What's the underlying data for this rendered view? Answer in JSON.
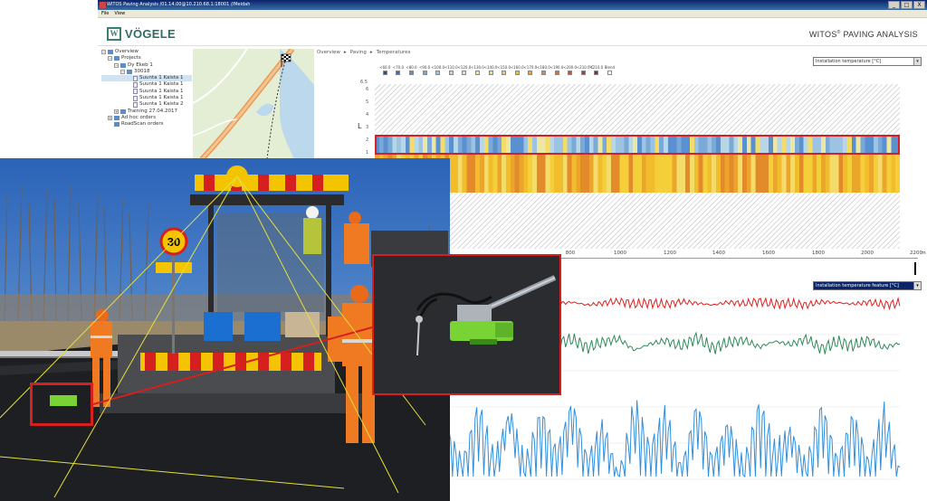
{
  "window": {
    "title": "WITOS Paving Analysis /01.14.00@10.210.68.1:18001 //Meidah",
    "buttons": [
      "_",
      "□",
      "X"
    ]
  },
  "menu": [
    "File",
    "View"
  ],
  "header": {
    "logo_mark": "W",
    "logo_text": "VÖGELE",
    "app_title": "WITOS",
    "app_title_reg": "®",
    "app_title_rest": " PAVING ANALYSIS"
  },
  "tree": [
    {
      "label": "Overview",
      "level": 0,
      "box": "−",
      "icon": "folder"
    },
    {
      "label": "Projects",
      "level": 1,
      "box": "−",
      "icon": "folder"
    },
    {
      "label": "Dy Ekeb 1",
      "level": 2,
      "box": "−",
      "icon": "folder"
    },
    {
      "label": "30018",
      "level": 3,
      "box": "−",
      "icon": "folder"
    },
    {
      "label": "Suunta 1 Kaista 1",
      "level": 4,
      "box": "",
      "icon": "doc",
      "selected": true
    },
    {
      "label": "Suunta 1 Kaista 1",
      "level": 4,
      "box": "",
      "icon": "doc"
    },
    {
      "label": "Suunta 1 Kaista 1",
      "level": 4,
      "box": "",
      "icon": "doc"
    },
    {
      "label": "Suunta 1 Kaista 1",
      "level": 4,
      "box": "",
      "icon": "doc"
    },
    {
      "label": "Suunta 1 Kaista 2",
      "level": 4,
      "box": "",
      "icon": "doc"
    },
    {
      "label": "Training 27.04.2017",
      "level": 2,
      "box": "+",
      "icon": "folder"
    },
    {
      "label": "Ad hoc orders",
      "level": 1,
      "box": "+",
      "icon": "folder"
    },
    {
      "label": "RoadScan orders",
      "level": 1,
      "box": "",
      "icon": "folder"
    }
  ],
  "breadcrumb": [
    "Overview",
    "▸",
    "Paving",
    "▸",
    "Temperatures"
  ],
  "select_top": {
    "value": "Installation temperature [°C]"
  },
  "select_bottom": {
    "value": "Installation temperature feature [°C]"
  },
  "legend": {
    "labels": [
      "<60.0",
      "<70.0",
      "<80.0",
      "<90.0",
      "<100.0",
      "<110.0",
      "<120.0",
      "<130.0",
      "<140.0",
      "<150.0",
      "<160.0",
      "<170.0",
      "<180.0",
      "<190.0",
      "<200.0",
      "<210.0",
      "<210.0",
      "Blend"
    ],
    "colors": [
      "#2a4f8f",
      "#3b6bb4",
      "#5a8fd0",
      "#7aa9d8",
      "#9cc3e2",
      "#b9d6e6",
      "#d6e5d1",
      "#ece7a5",
      "#f4dc6a",
      "#f5cf3a",
      "#f2bd2c",
      "#eba52a",
      "#e38b2a",
      "#da6f29",
      "#cf5127",
      "#c23424",
      "#a81d1d",
      "#ffffff"
    ],
    "unit": "°C"
  },
  "heatmap": {
    "y_ticks": [
      "6.5",
      "6",
      "5",
      "4",
      "3",
      "2",
      "1"
    ],
    "y_label": "L"
  },
  "x_axis": {
    "ticks": [
      "800",
      "1000",
      "1200",
      "1400",
      "1600",
      "1800",
      "2000",
      "2200"
    ],
    "unit": "m"
  },
  "chart_data": {
    "type": "line",
    "title": "",
    "xlabel": "",
    "ylabel": "",
    "series": [
      {
        "name": "",
        "color": "#e02020",
        "level": "high",
        "values": [
          0.9,
          0.86,
          0.93,
          0.88,
          0.91,
          0.87,
          0.94,
          0.89,
          0.92,
          0.86,
          0.9,
          0.95,
          0.88,
          0.91,
          0.87,
          0.93,
          0.9,
          0.86,
          0.92,
          0.89,
          0.94,
          0.88,
          0.9,
          0.86,
          0.93,
          0.91,
          0.88,
          0.92,
          0.87,
          0.9
        ]
      },
      {
        "name": "",
        "color": "#2e8b57",
        "level": "mid",
        "values": [
          0.72,
          0.8,
          0.65,
          0.78,
          0.7,
          0.83,
          0.66,
          0.75,
          0.81,
          0.68,
          0.77,
          0.82,
          0.64,
          0.74,
          0.79,
          0.7,
          0.84,
          0.67,
          0.76,
          0.8,
          0.69,
          0.78,
          0.73,
          0.82,
          0.66,
          0.77,
          0.71,
          0.8,
          0.68,
          0.75
        ]
      },
      {
        "name": "",
        "color": "#2f8fdc",
        "level": "low",
        "values": [
          0.4,
          0.1,
          0.55,
          0.15,
          0.6,
          0.08,
          0.5,
          0.2,
          0.62,
          0.12,
          0.45,
          0.05,
          0.58,
          0.18,
          0.52,
          0.1,
          0.6,
          0.14,
          0.48,
          0.06,
          0.55,
          0.2,
          0.44,
          0.1,
          0.57,
          0.15,
          0.5,
          0.08,
          0.53,
          0.12
        ]
      }
    ]
  },
  "photo": {
    "speed_sign": "30"
  }
}
